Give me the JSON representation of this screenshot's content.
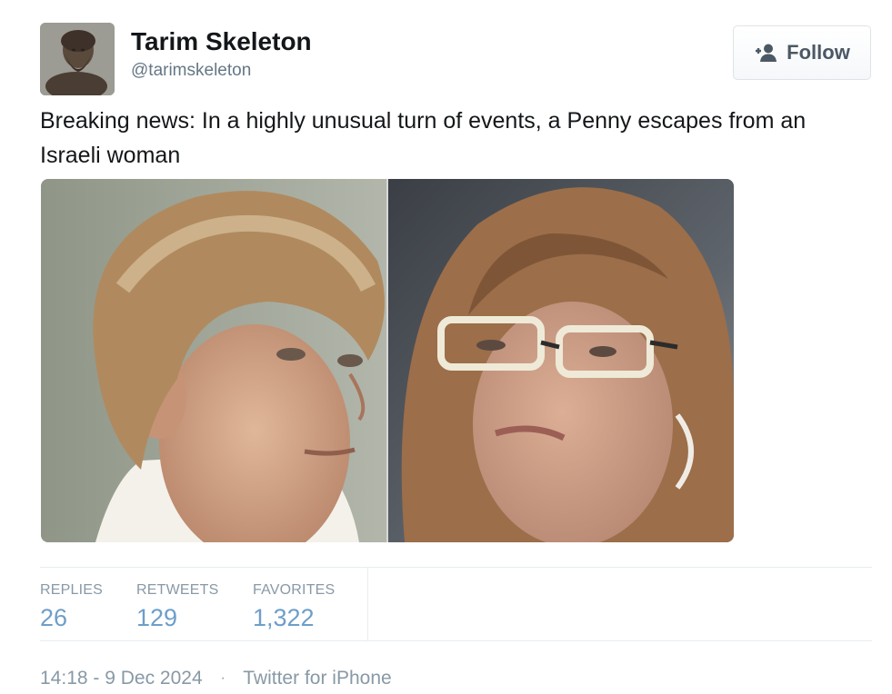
{
  "user": {
    "display_name": "Tarim Skeleton",
    "screen_name": "@tarimskeleton",
    "avatar_icon": "bearded-statue-avatar"
  },
  "follow_button": {
    "label": "Follow",
    "icon": "add-user-icon"
  },
  "tweet": {
    "text": "Breaking news: In a highly unusual turn of events, a Penny escapes from an Israeli woman",
    "media_description_icon": "two-portraits-photo"
  },
  "stats": [
    {
      "label": "REPLIES",
      "value": "26"
    },
    {
      "label": "RETWEETS",
      "value": "129"
    },
    {
      "label": "FAVORITES",
      "value": "1,322"
    }
  ],
  "meta": {
    "timestamp": "14:18 - 9 Dec 2024",
    "separator": "·",
    "source": "Twitter for iPhone"
  },
  "colors": {
    "stat_value": "#6e9ec9",
    "muted": "#8899a6",
    "text": "#14171a",
    "divider": "#e6ecf0"
  }
}
